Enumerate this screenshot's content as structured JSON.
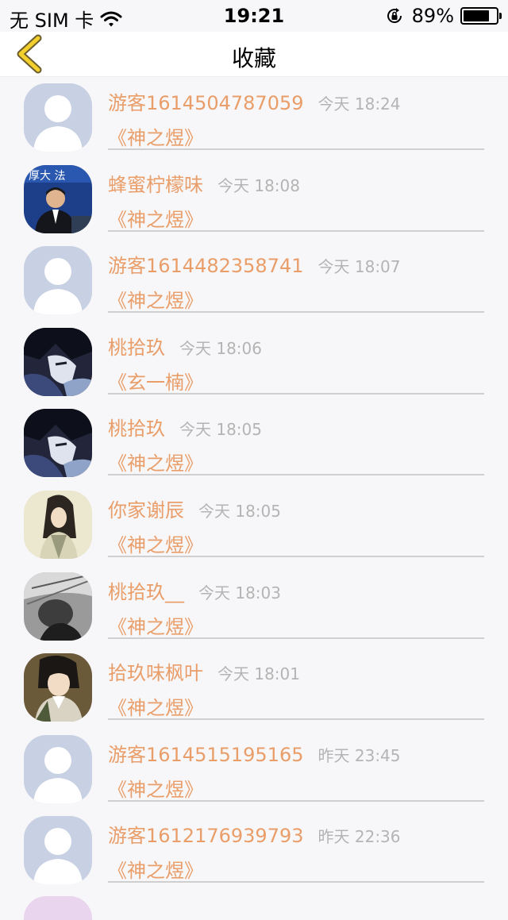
{
  "status_bar": {
    "carrier": "无 SIM 卡",
    "time": "19:21",
    "battery_percent": "89%",
    "battery_level": 0.89
  },
  "nav": {
    "title": "收藏"
  },
  "items": [
    {
      "name": "游客1614504787059",
      "time": "今天 18:24",
      "book": "《神之煜》",
      "avatar": "default"
    },
    {
      "name": "蜂蜜柠檬味",
      "time": "今天 18:08",
      "book": "《神之煜》",
      "avatar": "photo-man"
    },
    {
      "name": "游客1614482358741",
      "time": "今天 18:07",
      "book": "《神之煜》",
      "avatar": "default"
    },
    {
      "name": "桃拾玖",
      "time": "今天 18:06",
      "book": "《玄一楠》",
      "avatar": "anime-dark"
    },
    {
      "name": "桃拾玖",
      "time": "今天 18:05",
      "book": "《神之煜》",
      "avatar": "anime-dark"
    },
    {
      "name": "你家谢辰",
      "time": "今天 18:05",
      "book": "《神之煜》",
      "avatar": "ancient-man"
    },
    {
      "name": "桃拾玖__",
      "time": "今天 18:03",
      "book": "《神之煜》",
      "avatar": "bw-photo"
    },
    {
      "name": "拾玖味枫叶",
      "time": "今天 18:01",
      "book": "《神之煜》",
      "avatar": "anime-soldier"
    },
    {
      "name": "游客1614515195165",
      "time": "昨天 23:45",
      "book": "《神之煜》",
      "avatar": "default"
    },
    {
      "name": "游客1612176939793",
      "time": "昨天 22:36",
      "book": "《神之煜》",
      "avatar": "default"
    }
  ],
  "colors": {
    "accent_text": "#e99e6a",
    "time_text": "#b4b4b4",
    "back_icon": "#f2cf2c",
    "background": "#f7f6f8"
  }
}
